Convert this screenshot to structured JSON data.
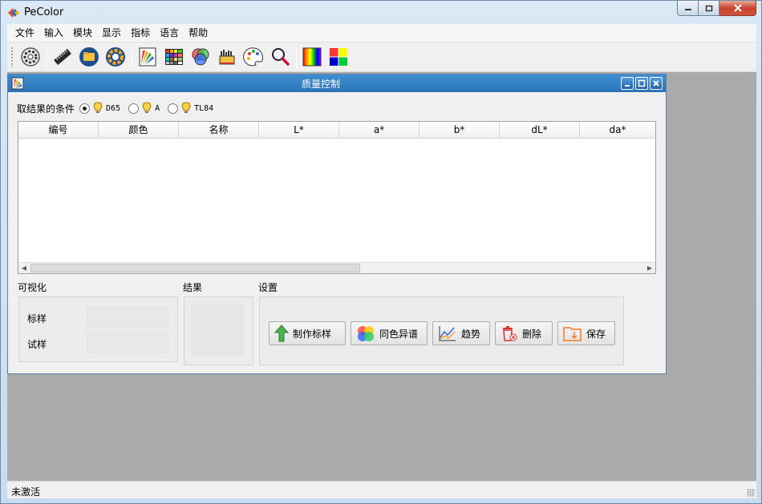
{
  "app": {
    "title": "PeColor"
  },
  "menu": [
    "文件",
    "输入",
    "模块",
    "显示",
    "指标",
    "语言",
    "帮助"
  ],
  "toolbar": {
    "icons": [
      "settings-gear-icon",
      "ruler-icon",
      "folder-open-icon",
      "color-wheel-icon",
      "color-fan-deck-icon",
      "color-grid-icon",
      "rgb-circles-icon",
      "paint-brush-icon",
      "palette-icon",
      "magnifier-icon",
      "spectrum-icon",
      "color-square-icon"
    ]
  },
  "child_window": {
    "title": "质量控制"
  },
  "conditions": {
    "label": "取结果的条件",
    "options": [
      {
        "label": "D65",
        "selected": true
      },
      {
        "label": "A",
        "selected": false
      },
      {
        "label": "TL84",
        "selected": false
      }
    ]
  },
  "table": {
    "columns": [
      "编号",
      "颜色",
      "名称",
      "L*",
      "a*",
      "b*",
      "dL*",
      "da*"
    ],
    "rows": []
  },
  "visualization": {
    "label": "可视化",
    "standard_label": "标样",
    "trial_label": "试样"
  },
  "results": {
    "label": "结果"
  },
  "settings": {
    "label": "设置",
    "buttons": {
      "make_standard": "制作标样",
      "metamerism": "同色异谱",
      "trend": "趋势",
      "delete": "删除",
      "save": "保存"
    }
  },
  "status": {
    "text": "未激活"
  }
}
